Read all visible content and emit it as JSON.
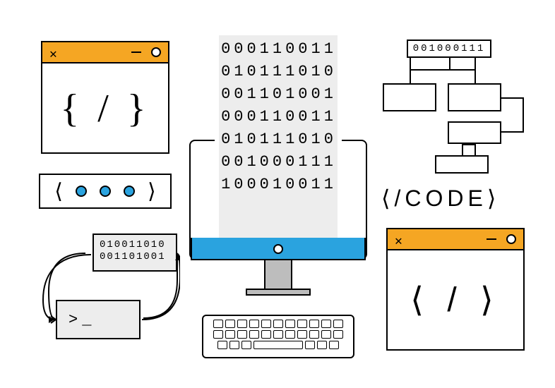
{
  "window_a": {
    "close_glyph": "✕",
    "body_text": "{ / }"
  },
  "loader": {
    "left_chevron": "⟨",
    "right_chevron": "⟩"
  },
  "cycle": {
    "binary_line1": "010011010",
    "binary_line2": "001101001",
    "terminal_prompt": ">_"
  },
  "binary_stream": {
    "line1": "000110011",
    "line2": "010111010",
    "line3": "001101001",
    "line4": "000110011",
    "line5": "010111010",
    "line6": "001000111",
    "line7": "100010011"
  },
  "flowchart": {
    "top_label": "001000111"
  },
  "code_tag": {
    "text": "⟨/CODE⟩"
  },
  "window_b": {
    "close_glyph": "✕",
    "body_text": "⟨ / ⟩"
  }
}
